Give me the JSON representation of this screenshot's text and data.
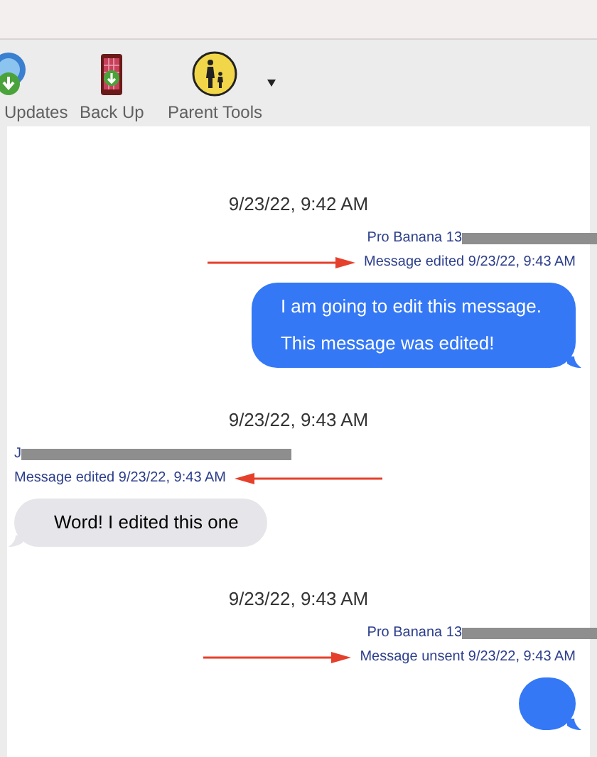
{
  "toolbar": [
    {
      "label": "Updates",
      "menu": false
    },
    {
      "label": "Back Up",
      "menu": false
    },
    {
      "label": "Parent Tools",
      "menu": true
    }
  ],
  "conversation": [
    {
      "kind": "timestamp",
      "text": "9/23/22, 9:42 AM"
    },
    {
      "kind": "outgoing",
      "sender": "Pro Banana 13",
      "redacted": true,
      "status": "Message edited 9/23/22, 9:43 AM",
      "annotated": true,
      "paragraphs": [
        "I am going to edit this message.",
        "This message was edited!"
      ]
    },
    {
      "kind": "timestamp",
      "text": "9/23/22, 9:43 AM"
    },
    {
      "kind": "incoming",
      "sender": "J",
      "redacted": true,
      "status": "Message edited 9/23/22, 9:43 AM",
      "annotated": true,
      "paragraphs": [
        "Word! I edited this one"
      ]
    },
    {
      "kind": "timestamp",
      "text": "9/23/22, 9:43 AM"
    },
    {
      "kind": "outgoing",
      "sender": "Pro Banana 13",
      "redacted": true,
      "status": "Message unsent 9/23/22, 9:43 AM",
      "annotated": true
    }
  ]
}
